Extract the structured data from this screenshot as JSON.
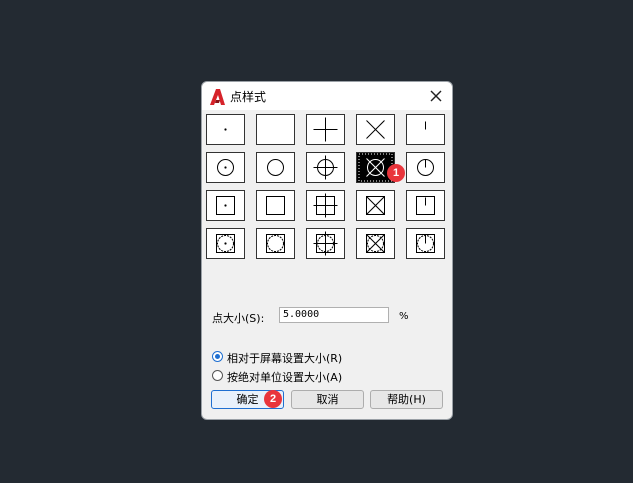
{
  "dialog": {
    "title": "点样式",
    "point_styles": [
      "dot",
      "none",
      "plus",
      "cross",
      "tick",
      "circle-dot",
      "circle",
      "circle-plus",
      "circle-cross",
      "circle-tick",
      "square-dot",
      "square",
      "square-plus",
      "square-cross",
      "square-tick",
      "square-circle-dot",
      "square-circle",
      "square-circle-plus",
      "square-circle-cross",
      "square-circle-tick"
    ],
    "selected_style_index": 8,
    "point_size_label": "点大小(S):",
    "point_size_value": "5.0000",
    "point_size_unit": "%",
    "radio_relative_label": "相对于屏幕设置大小(R)",
    "radio_absolute_label": "按绝对单位设置大小(A)",
    "selected_radio": "relative",
    "ok_label": "确定",
    "cancel_label": "取消",
    "help_label": "帮助(H)"
  },
  "annotations": {
    "badge1": "1",
    "badge2": "2"
  },
  "colors": {
    "accent": "#1f6fd1",
    "badge": "#e9353c",
    "background": "#232a32",
    "app_icon": "#d6232a"
  }
}
